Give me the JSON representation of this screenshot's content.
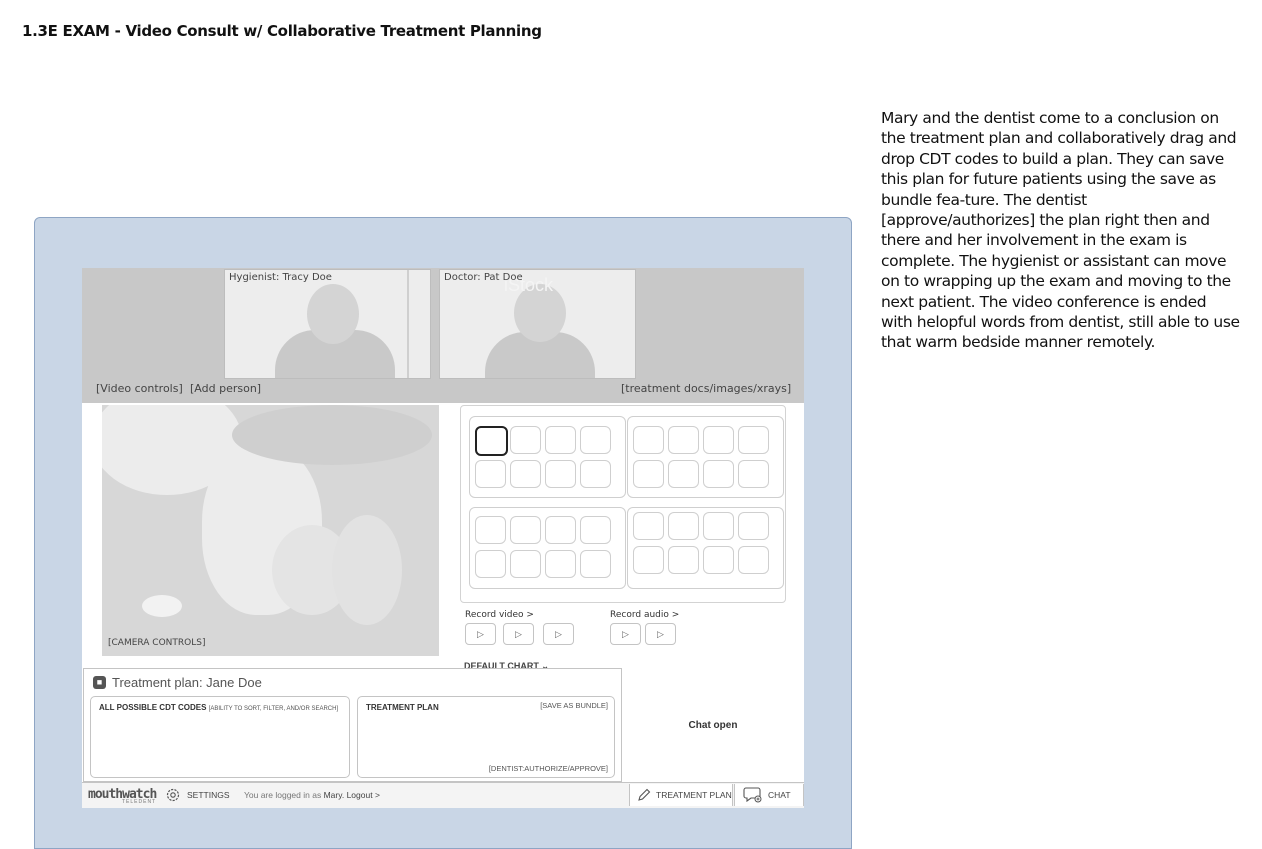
{
  "page_title": "1.3E EXAM - Video Consult w/ Collaborative Treatment Planning",
  "description": "Mary and the dentist come to a conclusion on the treatment plan and collaboratively drag and drop CDT codes to build a plan. They can save this plan for future patients using the save as bundle fea-ture. The dentist [approve/authorizes] the plan right then and there and her involvement in the exam is complete. The hygienist or assistant can move on to wrapping up the exam and moving to the next patient. The video conference is ended with helopful words from dentist, still able to use that warm bedside manner remotely.",
  "video_bar": {
    "hygienist_label": "Hygienist: Tracy Doe",
    "doctor_label": "Doctor: Pat Doe",
    "watermark": "iStock",
    "video_controls": "[Video controls]",
    "add_person": "[Add person]",
    "treatment_docs": "[treatment docs/images/xrays]"
  },
  "camera": {
    "controls_label": "[CAMERA CONTROLS]"
  },
  "chart": {
    "record_video": "Record video >",
    "record_audio": "Record audio >",
    "play_glyph": "▷",
    "default_chart": "DEFAULT CHART ⌄"
  },
  "treatment_plan": {
    "title": "Treatment plan: Jane Doe",
    "all_codes_title": "ALL POSSIBLE CDT CODES",
    "all_codes_note": "[ABILITY TO SORT, FILTER, AND/OR SEARCH]",
    "plan_title": "TREATMENT PLAN",
    "save_bundle": "[SAVE AS BUNDLE]",
    "authorize": "[DENTIST:AUTHORIZE/APPROVE]"
  },
  "chat": {
    "status": "Chat open"
  },
  "footer": {
    "logo": "mouthwatch",
    "logo_sub": "TELEDENT",
    "settings": "SETTINGS",
    "logged_in_prefix": "You are logged in as",
    "user": "Mary.",
    "logout": "Logout >",
    "treatment_plan_btn": "TREATMENT PLAN",
    "chat_btn": "CHAT"
  }
}
